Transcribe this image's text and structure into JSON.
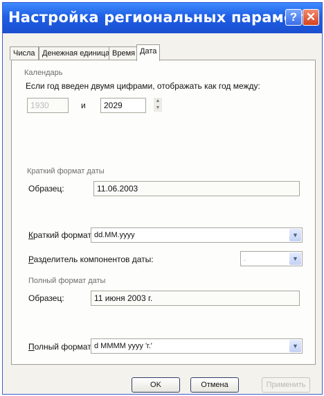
{
  "window": {
    "title": "Настройка региональных парамет...",
    "help_glyph": "?",
    "close_glyph": "✕"
  },
  "tabs": [
    "Числа",
    "Денежная единица",
    "Время",
    "Дата"
  ],
  "active_tab": "Дата",
  "calendar": {
    "group_label": "Календарь",
    "instruction": "Если год введен двумя цифрами, отображать как год между:",
    "year_from": "1930",
    "and_label": "и",
    "year_to": "2029"
  },
  "short_format": {
    "group_label": "Краткий формат даты",
    "sample_label": "Образец:",
    "sample_value": "11.06.2003",
    "format_label": "Краткий формат:",
    "format_value": "dd.MM.yyyy",
    "separator_label": "Разделитель компонентов даты:",
    "separator_value": "."
  },
  "long_format": {
    "group_label": "Полный формат даты",
    "sample_label": "Образец:",
    "sample_value": "11 июня 2003 г.",
    "format_label": "Полный формат:",
    "format_value": "d MMMM yyyy 'г.'"
  },
  "buttons": {
    "ok": "OK",
    "cancel": "Отмена",
    "apply": "Применить"
  }
}
